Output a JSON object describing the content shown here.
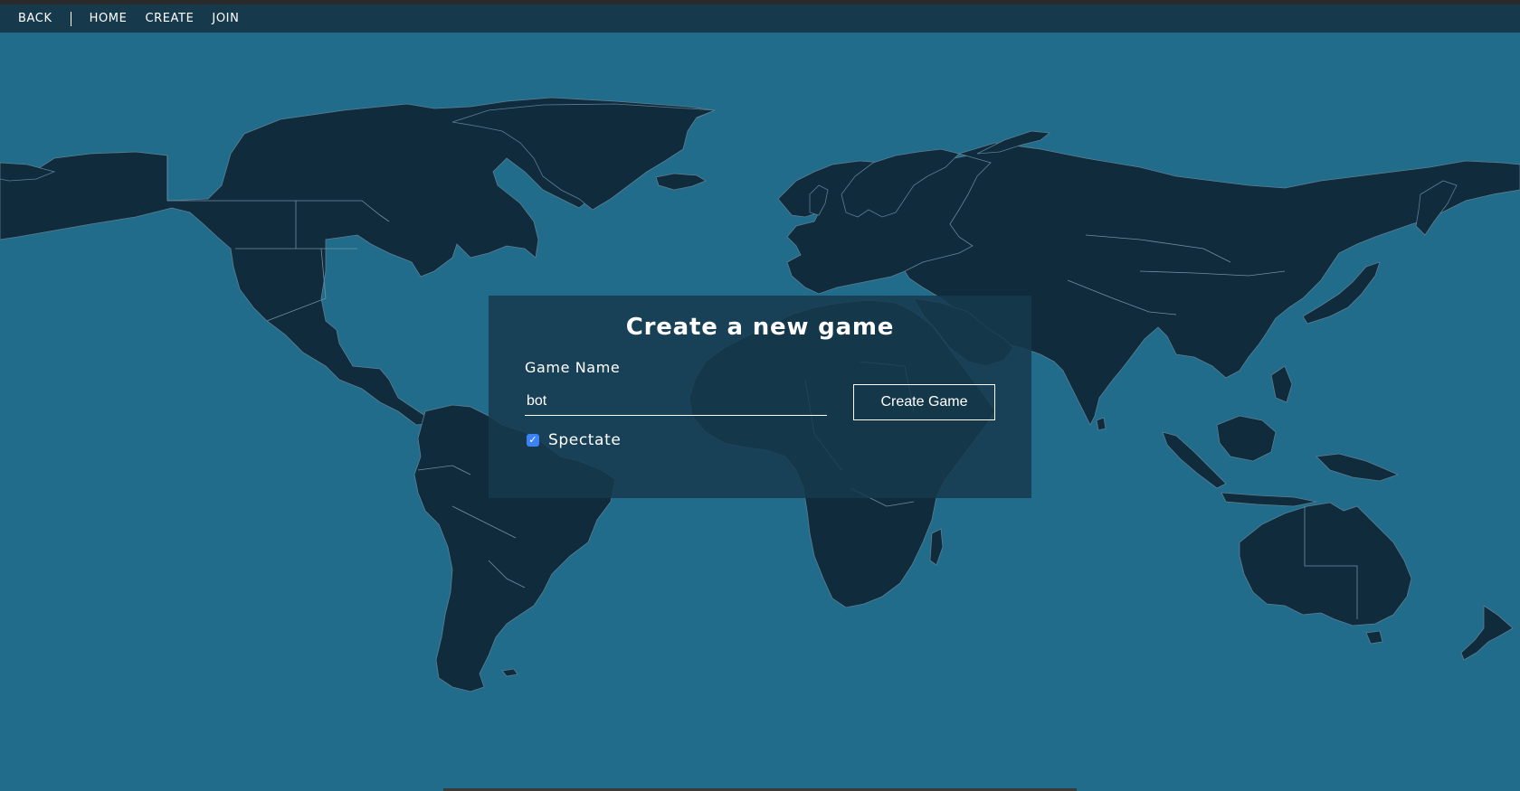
{
  "nav": {
    "back": "BACK",
    "home": "HOME",
    "create": "CREATE",
    "join": "JOIN"
  },
  "modal": {
    "title": "Create a new game",
    "game_name_label": "Game Name",
    "game_name_value": "bot",
    "create_button": "Create Game",
    "spectate_label": "Spectate",
    "spectate_checked": true
  },
  "colors": {
    "ocean": "#226c8b",
    "land": "#102b3b",
    "navbar": "#163a4c",
    "checkbox": "#3b82f6"
  }
}
